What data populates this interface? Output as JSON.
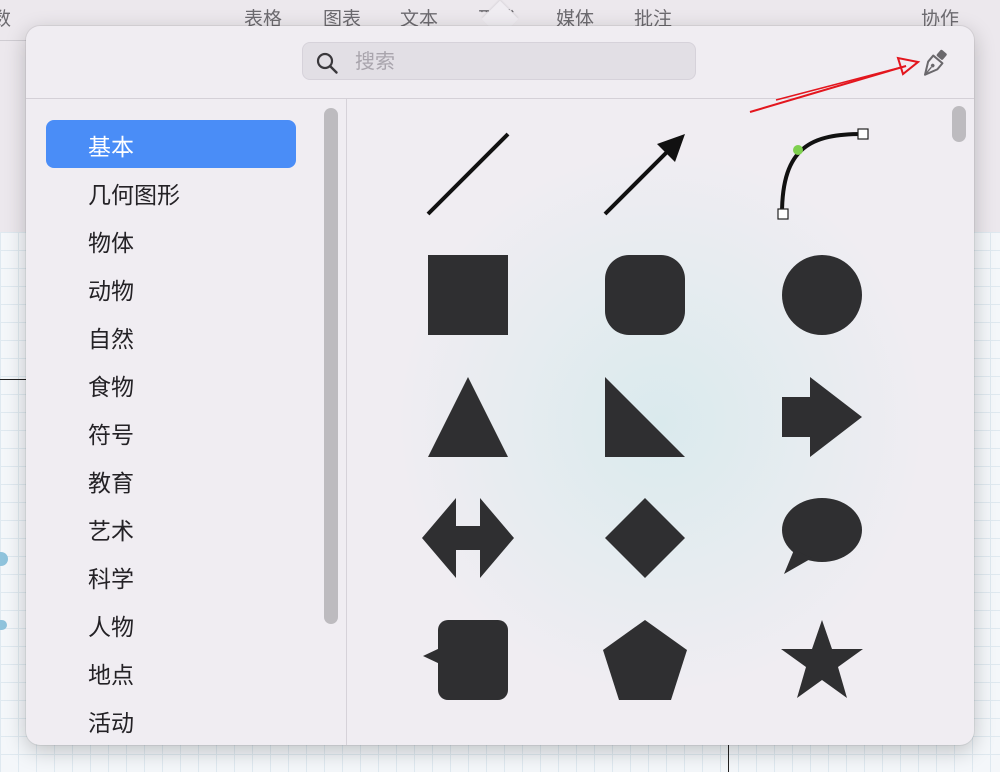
{
  "toolbar": {
    "items": [
      {
        "label": "数"
      },
      {
        "label": "表格"
      },
      {
        "label": "图表"
      },
      {
        "label": "文本"
      },
      {
        "label": "形状"
      },
      {
        "label": "媒体"
      },
      {
        "label": "批注"
      },
      {
        "label": "协作"
      }
    ]
  },
  "search": {
    "placeholder": "搜索",
    "value": "",
    "icon": "search-icon"
  },
  "pen_button": {
    "icon": "pen-icon"
  },
  "categories": [
    {
      "label": "基本",
      "selected": true
    },
    {
      "label": "几何图形"
    },
    {
      "label": "物体"
    },
    {
      "label": "动物"
    },
    {
      "label": "自然"
    },
    {
      "label": "食物"
    },
    {
      "label": "符号"
    },
    {
      "label": "教育"
    },
    {
      "label": "艺术"
    },
    {
      "label": "科学"
    },
    {
      "label": "人物"
    },
    {
      "label": "地点"
    },
    {
      "label": "活动"
    }
  ],
  "shapes": [
    "line",
    "arrow-line",
    "curve",
    "square",
    "rounded-square",
    "circle",
    "triangle",
    "right-triangle",
    "arrow-right",
    "double-arrow",
    "diamond",
    "speech-bubble",
    "callout-square",
    "pentagon",
    "star"
  ],
  "colors": {
    "accent": "#4a8df7",
    "shape_fill": "#2f2f31",
    "annotation_arrow": "#e3161e",
    "curve_handle": "#7ed04f"
  }
}
